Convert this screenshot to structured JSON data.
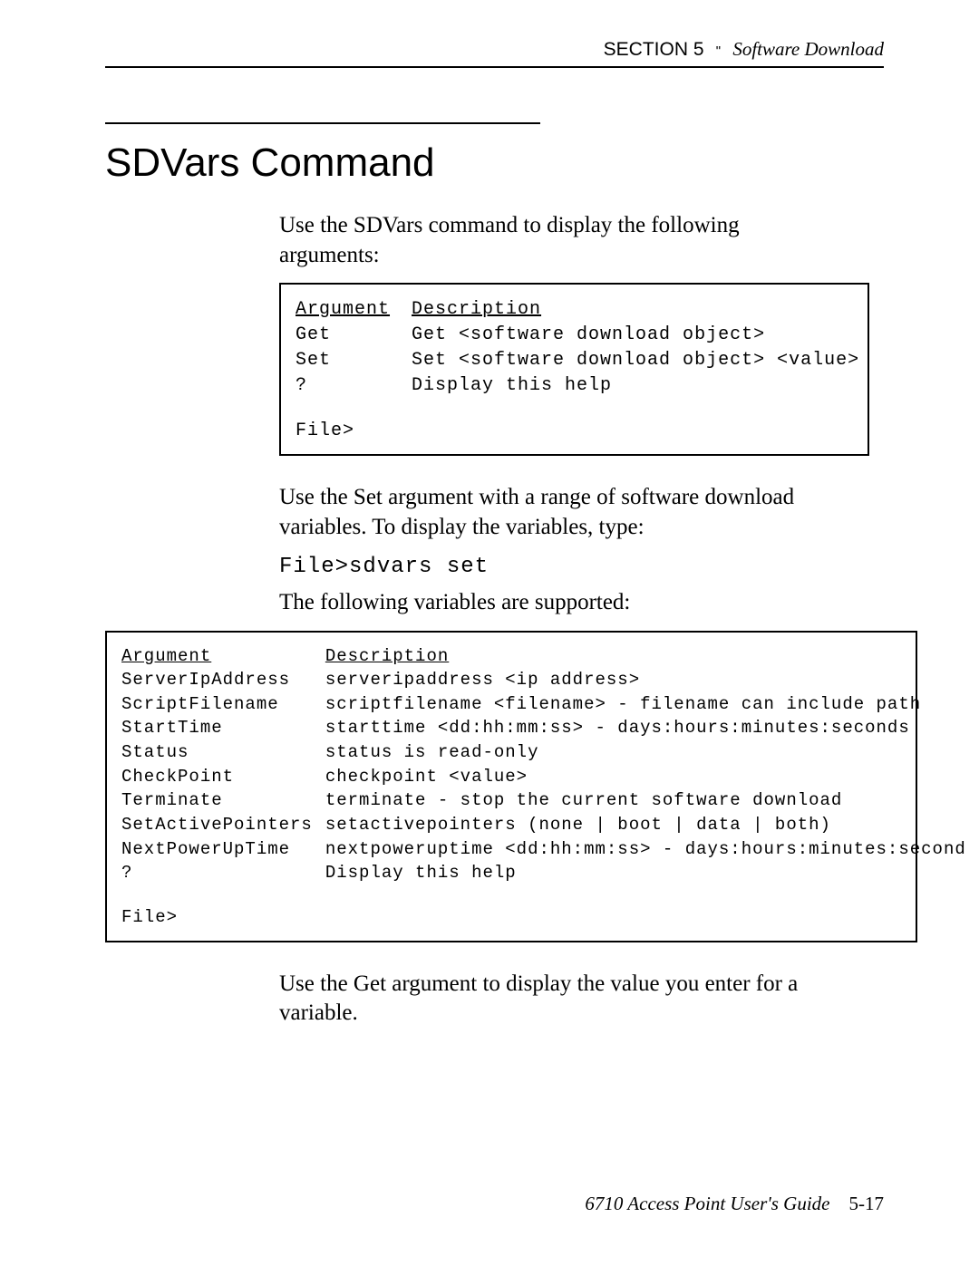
{
  "header": {
    "section_label": "SECTION 5",
    "chapter_title": "Software Download"
  },
  "title": "SDVars Command",
  "intro": "Use the SDVars command to display the following arguments:",
  "box1": {
    "hdr_arg": "Argument",
    "hdr_desc": "Description",
    "rows": [
      {
        "arg": "Get",
        "desc": "Get <software download object>"
      },
      {
        "arg": "Set",
        "desc": "Set <software download object> <value>"
      },
      {
        "arg": "?",
        "desc": "Display this help"
      }
    ],
    "prompt": "File>"
  },
  "set_intro": "Use the Set argument with a range of software download variables.  To display the variables, type:",
  "set_cmd": "File>sdvars set",
  "supported_intro": "The following variables are supported:",
  "box2": {
    "hdr_arg": "Argument",
    "hdr_desc": "Description",
    "rows": [
      {
        "arg": "ServerIpAddress",
        "desc": "serveripaddress <ip address>"
      },
      {
        "arg": "ScriptFilename",
        "desc": "scriptfilename <filename> - filename can include path"
      },
      {
        "arg": "StartTime",
        "desc": "starttime <dd:hh:mm:ss> - days:hours:minutes:seconds"
      },
      {
        "arg": "Status",
        "desc": "status is read-only"
      },
      {
        "arg": "CheckPoint",
        "desc": "checkpoint <value>"
      },
      {
        "arg": "Terminate",
        "desc": "terminate - stop the current software download"
      },
      {
        "arg": "SetActivePointers",
        "desc": "setactivepointers (none | boot | data | both)"
      },
      {
        "arg": "NextPowerUpTime",
        "desc": "nextpoweruptime <dd:hh:mm:ss> - days:hours:minutes:second"
      },
      {
        "arg": "?",
        "desc": "Display this help"
      }
    ],
    "prompt": "File>"
  },
  "get_intro": "Use the Get argument to display the value you enter for a variable.",
  "footer": {
    "guide": "6710 Access Point User's Guide",
    "page": "5-17"
  }
}
